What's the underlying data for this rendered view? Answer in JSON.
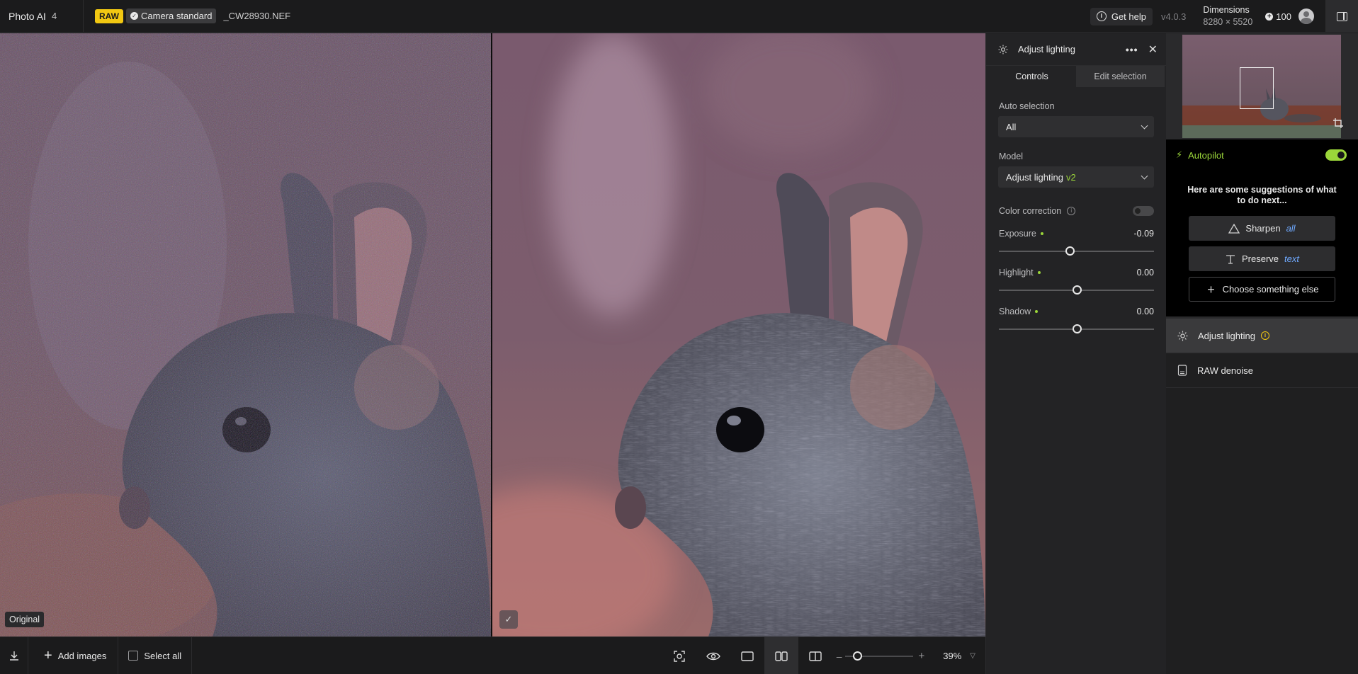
{
  "app": {
    "name": "Photo AI",
    "image_count": "4"
  },
  "file": {
    "raw_badge": "RAW",
    "camera_profile": "Camera standard",
    "name": "_CW28930.NEF"
  },
  "header": {
    "help_label": "Get help",
    "version": "v4.0.3",
    "dimensions_label": "Dimensions",
    "dimensions_value": "8280 × 5520",
    "credits": "100"
  },
  "canvas": {
    "left_label": "Original",
    "right_check": "✓"
  },
  "bottombar": {
    "add_images": "Add images",
    "select_all": "Select all",
    "zoom_level": "39%",
    "zoom_fraction": 0.18
  },
  "adjust_panel": {
    "title": "Adjust lighting",
    "tabs": [
      {
        "label": "Controls"
      },
      {
        "label": "Edit selection"
      }
    ],
    "auto_selection_label": "Auto selection",
    "auto_selection_value": "All",
    "model_label": "Model",
    "model_value": "Adjust lighting",
    "model_version": "v2",
    "color_correction_label": "Color correction",
    "color_correction_on": false,
    "sliders": [
      {
        "label": "Exposure",
        "value": "-0.09",
        "fraction": 0.455
      },
      {
        "label": "Highlight",
        "value": "0.00",
        "fraction": 0.5
      },
      {
        "label": "Shadow",
        "value": "0.00",
        "fraction": 0.5
      }
    ]
  },
  "right_panel": {
    "autopilot_label": "Autopilot",
    "autopilot_on": true,
    "suggestion_message": "Here are some suggestions of what to do next...",
    "suggestions": [
      {
        "verb": "Sharpen",
        "target": "all"
      },
      {
        "verb": "Preserve",
        "target": "text"
      }
    ],
    "choose_else": "Choose something else",
    "steps": [
      {
        "label": "Adjust lighting"
      },
      {
        "label": "RAW denoise"
      }
    ]
  },
  "colors": {
    "accent_green": "#9bd63a",
    "raw_yellow": "#f2c812",
    "link_blue": "#6fa9ff"
  }
}
